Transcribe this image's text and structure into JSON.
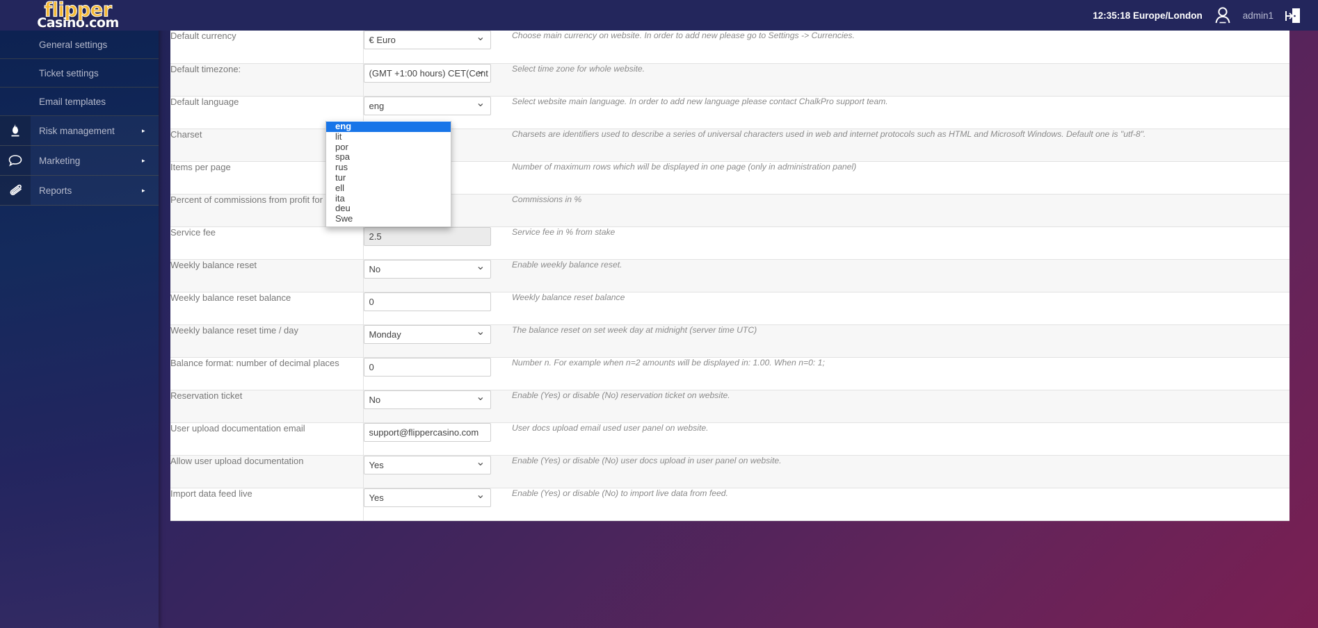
{
  "header": {
    "logo_line1": "flipper",
    "logo_line2": "Casino.com",
    "clock": "12:35:18 Europe/London",
    "username": "admin1",
    "user_icon": "user-avatar-icon",
    "logout_icon": "logout-door-icon"
  },
  "sidebar": {
    "items": [
      {
        "label": "General settings",
        "type": "sub",
        "icon": "",
        "caret": ""
      },
      {
        "label": "Ticket settings",
        "type": "sub",
        "icon": "",
        "caret": ""
      },
      {
        "label": "Email templates",
        "type": "sub",
        "icon": "",
        "caret": ""
      },
      {
        "label": "Risk management",
        "type": "main",
        "icon": "flame-icon",
        "caret": "▸"
      },
      {
        "label": "Marketing",
        "type": "main",
        "icon": "speech-bubble-icon",
        "caret": "▸"
      },
      {
        "label": "Reports",
        "type": "main",
        "icon": "paperclip-icon",
        "caret": "▸"
      }
    ]
  },
  "settings_rows": [
    {
      "label": "Default currency",
      "control": "select",
      "value": "€ Euro",
      "help": "Choose main currency on website. In order to add new please go to Settings -> Currencies."
    },
    {
      "label": "Default timezone:",
      "control": "select",
      "value": "(GMT +1:00 hours) CET(Cent",
      "help": "Select time zone for whole website."
    },
    {
      "label": "Default language",
      "control": "select",
      "value": "eng",
      "help": "Select website main language. In order to add new language please contact ChalkPro support team."
    },
    {
      "label": "Charset",
      "control": "hidden",
      "value": "",
      "help": "Charsets are identifiers used to describe a series of universal characters used in web and internet protocols such as HTML and Microsoft Windows. Default one is \"utf-8\"."
    },
    {
      "label": "Items per page",
      "control": "hidden",
      "value": "",
      "help": "Number of maximum rows which will be displayed in one page (only in administration panel)"
    },
    {
      "label": "Percent of commissions from profit for agent",
      "control": "hidden",
      "value": "",
      "help": "Commissions in %"
    },
    {
      "label": "Service fee",
      "control": "input-shaded",
      "value": "2.5",
      "help": "Service fee in % from stake"
    },
    {
      "label": "Weekly balance reset",
      "control": "select",
      "value": "No",
      "help": "Enable weekly balance reset."
    },
    {
      "label": "Weekly balance reset balance",
      "control": "input",
      "value": "0",
      "help": "Weekly balance reset balance"
    },
    {
      "label": "Weekly balance reset time / day",
      "control": "select",
      "value": "Monday",
      "help": "The balance reset on set week day at midnight (server time UTC)"
    },
    {
      "label": "Balance format: number of decimal places",
      "control": "input",
      "value": "0",
      "help": "Number n. For example when n=2 amounts will be displayed in: 1.00. When n=0: 1;"
    },
    {
      "label": "Reservation ticket",
      "control": "select",
      "value": "No",
      "help": "Enable (Yes) or disable (No) reservation ticket on website."
    },
    {
      "label": "User upload documentation email",
      "control": "input",
      "value": "support@flippercasino.com",
      "help": "User docs upload email used user panel on website."
    },
    {
      "label": "Allow user upload documentation",
      "control": "select",
      "value": "Yes",
      "help": "Enable (Yes) or disable (No) user docs upload in user panel on website."
    },
    {
      "label": "Import data feed live",
      "control": "select",
      "value": "Yes",
      "help": "Enable (Yes) or disable (No) to import live data from feed."
    }
  ],
  "language_dropdown": {
    "open": true,
    "selected": "eng",
    "options": [
      "eng",
      "lit",
      "por",
      "spa",
      "rus",
      "tur",
      "ell",
      "ita",
      "deu",
      "Swe"
    ]
  },
  "colors": {
    "topbar": "#23265c",
    "sidebar_top": "#0c2150",
    "accent_logo": "#f5b935",
    "dropdown_highlight": "#1875e8",
    "page_bg_start": "#1d2252",
    "page_bg_end": "#7a1f52"
  }
}
